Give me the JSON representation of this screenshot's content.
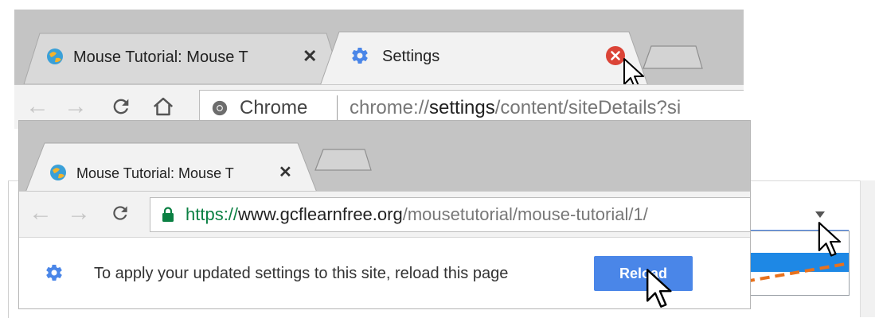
{
  "top_window": {
    "tabs": [
      {
        "title": "Mouse Tutorial: Mouse T",
        "close": "✕"
      },
      {
        "title": "Settings"
      }
    ],
    "omnibox": {
      "site_chip": "Chrome",
      "url_scheme": "chrome://",
      "url_host": "settings",
      "url_path": "/content/siteDetails?si"
    }
  },
  "bottom_window": {
    "tabs": [
      {
        "title": "Mouse Tutorial: Mouse T",
        "close": "✕"
      }
    ],
    "omnibox": {
      "url_scheme": "https://",
      "url_host": "www.gcflearnfree.org",
      "url_path": "/mousetutorial/mouse-tutorial/1/"
    },
    "infobar": {
      "message": "To apply your updated settings to this site, reload this page",
      "reload_label": "Reload"
    }
  },
  "colors": {
    "accent_blue": "#4a86e8",
    "close_hover_red": "#db4437",
    "lock_green": "#0b8043",
    "annotation_orange": "#e8711c"
  }
}
